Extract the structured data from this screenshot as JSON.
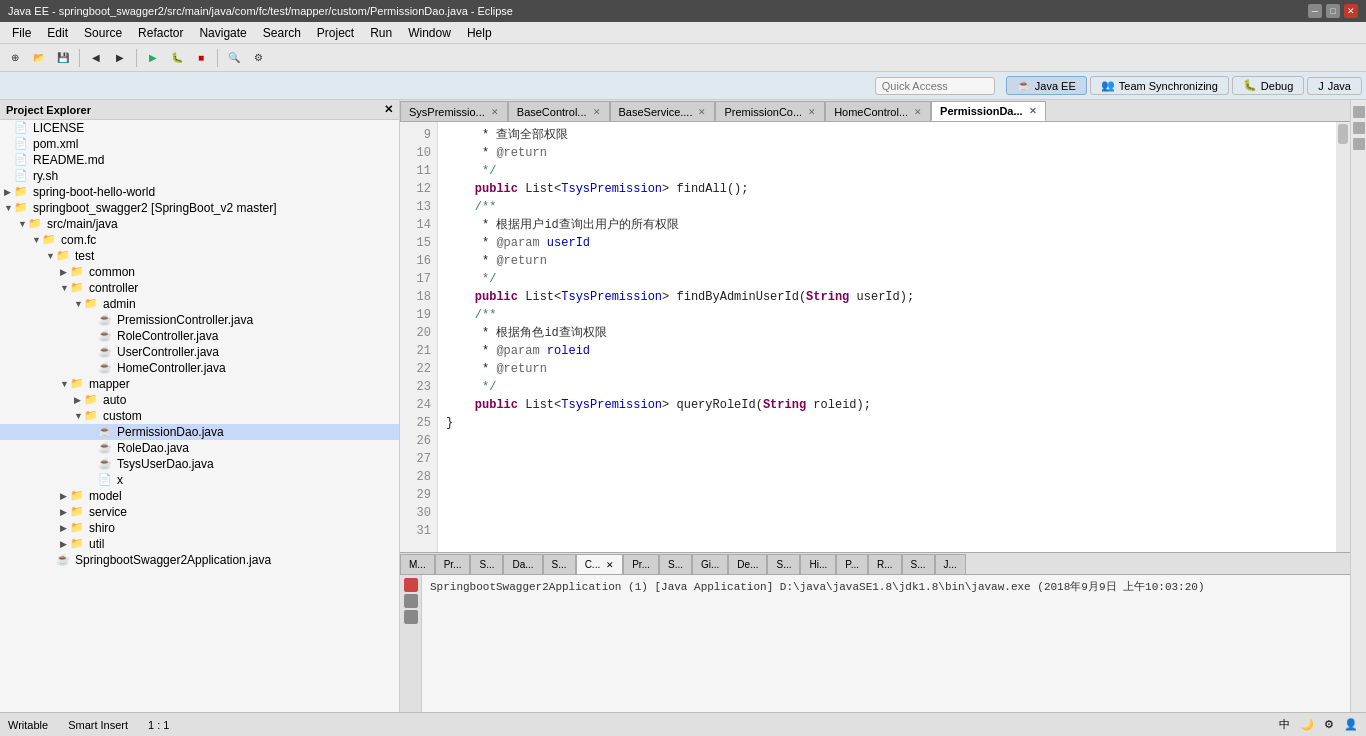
{
  "titlebar": {
    "title": "Java EE - springboot_swagger2/src/main/java/com/fc/test/mapper/custom/PermissionDao.java - Eclipse",
    "min": "─",
    "max": "□",
    "close": "✕"
  },
  "menubar": {
    "items": [
      "File",
      "Edit",
      "Source",
      "Refactor",
      "Navigate",
      "Search",
      "Project",
      "Run",
      "Window",
      "Help"
    ]
  },
  "perspbar": {
    "search_placeholder": "Quick Access",
    "perspectives": [
      "Java EE",
      "Team Synchronizing",
      "Debug",
      "Java"
    ]
  },
  "explorer": {
    "title": "Project Explorer",
    "items": [
      {
        "indent": 0,
        "arrow": "",
        "icon": "📄",
        "label": "LICENSE"
      },
      {
        "indent": 0,
        "arrow": "",
        "icon": "📄",
        "label": "pom.xml"
      },
      {
        "indent": 0,
        "arrow": "",
        "icon": "📄",
        "label": "README.md"
      },
      {
        "indent": 0,
        "arrow": "",
        "icon": "📄",
        "label": "ry.sh"
      },
      {
        "indent": 0,
        "arrow": "▶",
        "icon": "📁",
        "label": "spring-boot-hello-world"
      },
      {
        "indent": 0,
        "arrow": "▼",
        "icon": "📁",
        "label": "springboot_swagger2  [SpringBoot_v2 master]"
      },
      {
        "indent": 1,
        "arrow": "▼",
        "icon": "📁",
        "label": "src/main/java"
      },
      {
        "indent": 2,
        "arrow": "▼",
        "icon": "📁",
        "label": "com.fc"
      },
      {
        "indent": 3,
        "arrow": "▼",
        "icon": "📁",
        "label": "test"
      },
      {
        "indent": 4,
        "arrow": "▶",
        "icon": "📁",
        "label": "common"
      },
      {
        "indent": 4,
        "arrow": "▼",
        "icon": "📁",
        "label": "controller"
      },
      {
        "indent": 5,
        "arrow": "▼",
        "icon": "📁",
        "label": "admin"
      },
      {
        "indent": 6,
        "arrow": "",
        "icon": "☕",
        "label": "PremissionController.java"
      },
      {
        "indent": 6,
        "arrow": "",
        "icon": "☕",
        "label": "RoleController.java"
      },
      {
        "indent": 6,
        "arrow": "",
        "icon": "☕",
        "label": "UserController.java"
      },
      {
        "indent": 6,
        "arrow": "",
        "icon": "☕",
        "label": "HomeController.java"
      },
      {
        "indent": 4,
        "arrow": "▼",
        "icon": "📁",
        "label": "mapper"
      },
      {
        "indent": 5,
        "arrow": "▶",
        "icon": "📁",
        "label": "auto"
      },
      {
        "indent": 5,
        "arrow": "▼",
        "icon": "📁",
        "label": "custom"
      },
      {
        "indent": 6,
        "arrow": "",
        "icon": "☕",
        "label": "PermissionDao.java"
      },
      {
        "indent": 6,
        "arrow": "",
        "icon": "☕",
        "label": "RoleDao.java"
      },
      {
        "indent": 6,
        "arrow": "",
        "icon": "☕",
        "label": "TsysUserDao.java"
      },
      {
        "indent": 6,
        "arrow": "",
        "icon": "📄",
        "label": "x"
      },
      {
        "indent": 4,
        "arrow": "▶",
        "icon": "📁",
        "label": "model"
      },
      {
        "indent": 4,
        "arrow": "▶",
        "icon": "📁",
        "label": "service"
      },
      {
        "indent": 4,
        "arrow": "▶",
        "icon": "📁",
        "label": "shiro"
      },
      {
        "indent": 4,
        "arrow": "▶",
        "icon": "📁",
        "label": "util"
      },
      {
        "indent": 3,
        "arrow": "",
        "icon": "☕",
        "label": "SpringbootSwagger2Application.java"
      }
    ]
  },
  "editor": {
    "tabs": [
      {
        "label": "SysPremissio...",
        "active": false
      },
      {
        "label": "BaseControl...",
        "active": false
      },
      {
        "label": "BaseService....",
        "active": false
      },
      {
        "label": "PremissionCo...",
        "active": false
      },
      {
        "label": "HomeControl...",
        "active": false
      },
      {
        "label": "PermissionDa...",
        "active": true
      }
    ],
    "lines": [
      {
        "n": 9,
        "code": "        查询全部权限"
      },
      {
        "n": 10,
        "code": "     * @return"
      },
      {
        "n": 11,
        "code": "     */"
      },
      {
        "n": 12,
        "code": "    public List<TsysPremission> findAll();"
      },
      {
        "n": 13,
        "code": ""
      },
      {
        "n": 14,
        "code": "    /**"
      },
      {
        "n": 15,
        "code": "        根据用户id查询出用户的所有权限"
      },
      {
        "n": 16,
        "code": "     * @param userId"
      },
      {
        "n": 17,
        "code": "     * @return"
      },
      {
        "n": 18,
        "code": "     */"
      },
      {
        "n": 19,
        "code": "    public List<TsysPremission> findByAdminUserId(String userId);"
      },
      {
        "n": 20,
        "code": ""
      },
      {
        "n": 21,
        "code": "    /**"
      },
      {
        "n": 22,
        "code": "        根据角色id查询权限"
      },
      {
        "n": 23,
        "code": "     * @param roleid"
      },
      {
        "n": 24,
        "code": "     * @return"
      },
      {
        "n": 25,
        "code": "     */"
      },
      {
        "n": 26,
        "code": "    public List<TsysPremission> queryRoleId(String roleid);"
      },
      {
        "n": 27,
        "code": ""
      },
      {
        "n": 28,
        "code": ""
      },
      {
        "n": 29,
        "code": ""
      },
      {
        "n": 30,
        "code": "}"
      },
      {
        "n": 31,
        "code": ""
      }
    ]
  },
  "bottom_panel": {
    "tabs": [
      "M...",
      "Pr...",
      "S...",
      "Da...",
      "S...",
      "C...",
      "Pr...",
      "S...",
      "Gi...",
      "De...",
      "S...",
      "Hi...",
      "P...",
      "R...",
      "S...",
      "J..."
    ],
    "active_tab": "C...",
    "console_text": "SpringbootSwagger2Application (1) [Java Application] D:\\java\\javaSE1.8\\jdk1.8\\bin\\javaw.exe (2018年9月9日 上午10:03:20)"
  },
  "statusbar": {
    "writable": "Writable",
    "insert": "Smart Insert",
    "position": "1 : 1"
  }
}
